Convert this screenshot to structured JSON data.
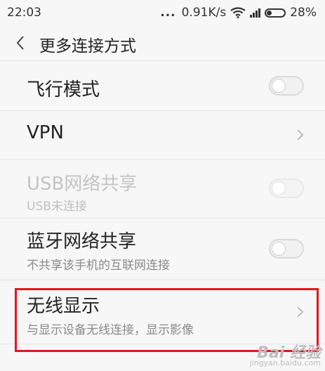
{
  "status_bar": {
    "time": "22:03",
    "dots": "...",
    "speed": "0.91K/s",
    "battery": "28%",
    "battery_level": 0.28,
    "icons": [
      "wifi-icon",
      "signal-icon",
      "battery-icon"
    ]
  },
  "header": {
    "back_icon": "chevron-left-icon",
    "title": "更多连接方式"
  },
  "items": [
    {
      "label": "飞行模式",
      "control": "toggle",
      "enabled": true,
      "on": false
    },
    {
      "label": "VPN",
      "control": "chevron",
      "enabled": true
    },
    {
      "label": "USB网络共享",
      "sub": "USB未连接",
      "control": "toggle",
      "enabled": false,
      "on": false
    },
    {
      "label": "蓝牙网络共享",
      "sub": "不共享该手机的互联网连接",
      "control": "toggle",
      "enabled": true,
      "on": false
    },
    {
      "label": "无线显示",
      "sub": "与显示设备无线连接，显示影像",
      "control": "chevron",
      "enabled": true,
      "highlighted": true
    }
  ],
  "colors": {
    "background": "#f7f7f7",
    "highlight": "#e8141e",
    "primary_text": "#222222",
    "secondary_text": "#8a8a8a",
    "disabled_text": "#c4c4c4"
  },
  "watermark": {
    "main": "Bai 经验",
    "sub": "jingyan.baidu.com"
  }
}
